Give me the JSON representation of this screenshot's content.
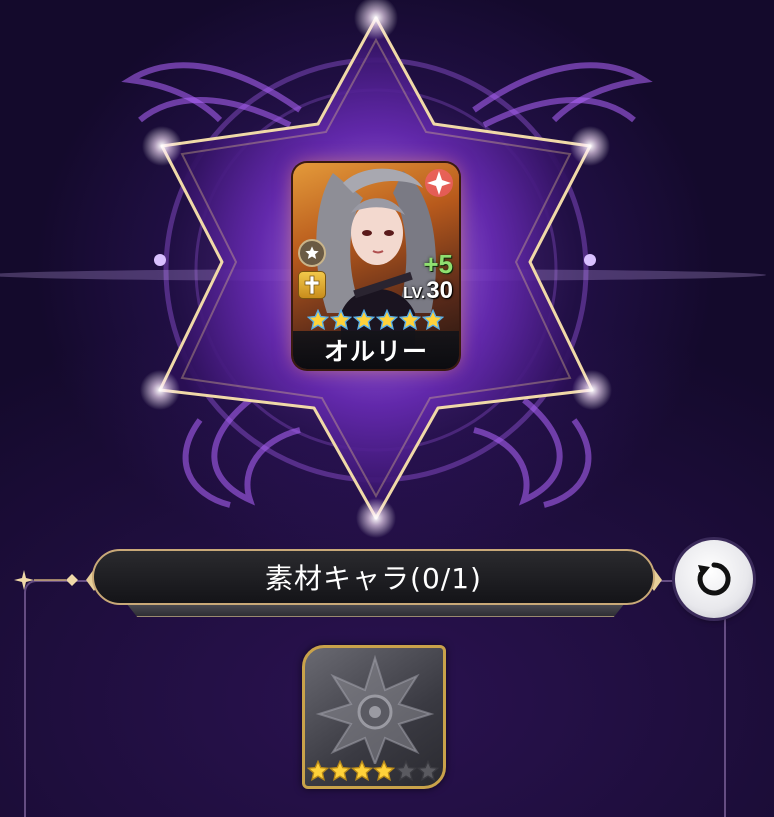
{
  "hero": {
    "name": "オルリー",
    "plus": "+5",
    "level_prefix": "LV.",
    "level": "30",
    "stars": 6,
    "star_color": "#ffd23a",
    "rarity_icon": "star-icon",
    "class_icon": "cross-icon"
  },
  "material": {
    "title": "素材キャラ(0/1)",
    "slot_stars_filled": 4,
    "slot_stars_total": 6
  },
  "colors": {
    "accent_gold": "#c9a978",
    "background": "#1b0c33",
    "emblem_glow": "#9b5de5"
  },
  "icons": {
    "reset": "reset-icon"
  }
}
